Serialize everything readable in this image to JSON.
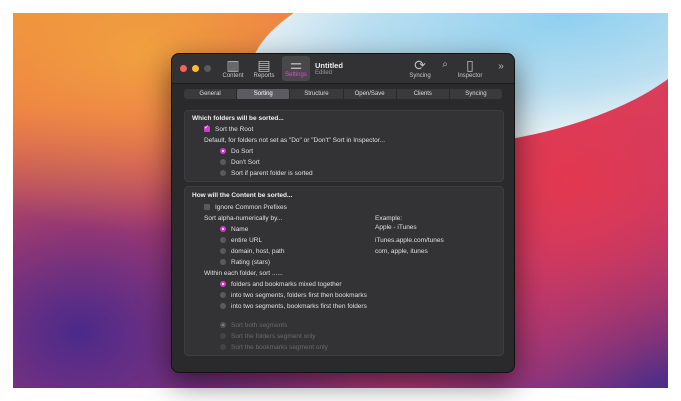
{
  "window": {
    "title": "Untitled",
    "subtitle": "Edited"
  },
  "toolbar": {
    "content_label": "Content",
    "reports_label": "Reports",
    "settings_label": "Settings",
    "syncing_label": "Syncing",
    "inspector_label": "Inspector",
    "more_label": "»",
    "accent_color": "#d33bc9"
  },
  "tabs": [
    "General",
    "Sorting",
    "Structure",
    "Open/Save",
    "Clients",
    "Syncing"
  ],
  "selected_tab": "Sorting",
  "section1": {
    "title": "Which folders will be sorted...",
    "sort_root": {
      "label": "Sort the Root",
      "checked": true
    },
    "default_text": "Default, for folders not set as \"Do\" or \"Don't\" Sort in Inspector...",
    "options": [
      {
        "label": "Do Sort",
        "selected": true
      },
      {
        "label": "Don't Sort",
        "selected": false
      },
      {
        "label": "Sort if parent folder is sorted",
        "selected": false
      }
    ]
  },
  "section2": {
    "title": "How will the Content be sorted...",
    "ignore_prefixes": {
      "label": "Ignore Common Prefixes",
      "checked": false
    },
    "alpha_label": "Sort alpha-numerically by...",
    "alpha_options": [
      {
        "label": "Name",
        "selected": true
      },
      {
        "label": "entire URL",
        "selected": false
      },
      {
        "label": "domain, host, path",
        "selected": false
      },
      {
        "label": "Rating (stars)",
        "selected": false
      }
    ],
    "example_label": "Example:",
    "example_values": [
      "Apple - iTunes",
      "iTunes.apple.com/tunes",
      "com, apple, itunes"
    ],
    "within_label": "Within each folder, sort ......",
    "within_options": [
      {
        "label": "folders and bookmarks mixed together",
        "selected": true
      },
      {
        "label": "into two segments, folders first then bookmarks",
        "selected": false
      },
      {
        "label": "into two segments, bookmarks first then folders",
        "selected": false
      }
    ],
    "segment_options": [
      {
        "label": "Sort both segments",
        "selected": true
      },
      {
        "label": "Sort the folders segment only",
        "selected": false
      },
      {
        "label": "Sort the bookmarks segment only",
        "selected": false
      }
    ]
  }
}
